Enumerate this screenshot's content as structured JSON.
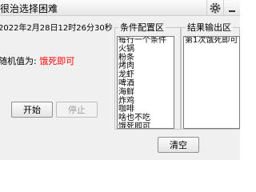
{
  "window": {
    "title": "很治选择困难",
    "settings_icon": "gear-icon",
    "minimize_icon": "minimize-icon"
  },
  "timer_text": "2022年2月28日12时26分30秒",
  "result": {
    "label": "随机值为: ",
    "value": "饿死即可",
    "value_color": "#ff0000"
  },
  "buttons": {
    "start": "开始",
    "stop": "停止",
    "clear": "清空"
  },
  "conditions": {
    "title": "条件配置区",
    "items": [
      "每行一个条件",
      "火锅",
      "粉条",
      "烤肉",
      "龙虾",
      "啤酒",
      "海鲜",
      "炸鸡",
      "咖啡",
      "啥也不吃",
      "饿死即可"
    ]
  },
  "output": {
    "title": "结果输出区",
    "items": [
      "第1次饿死即可"
    ]
  }
}
